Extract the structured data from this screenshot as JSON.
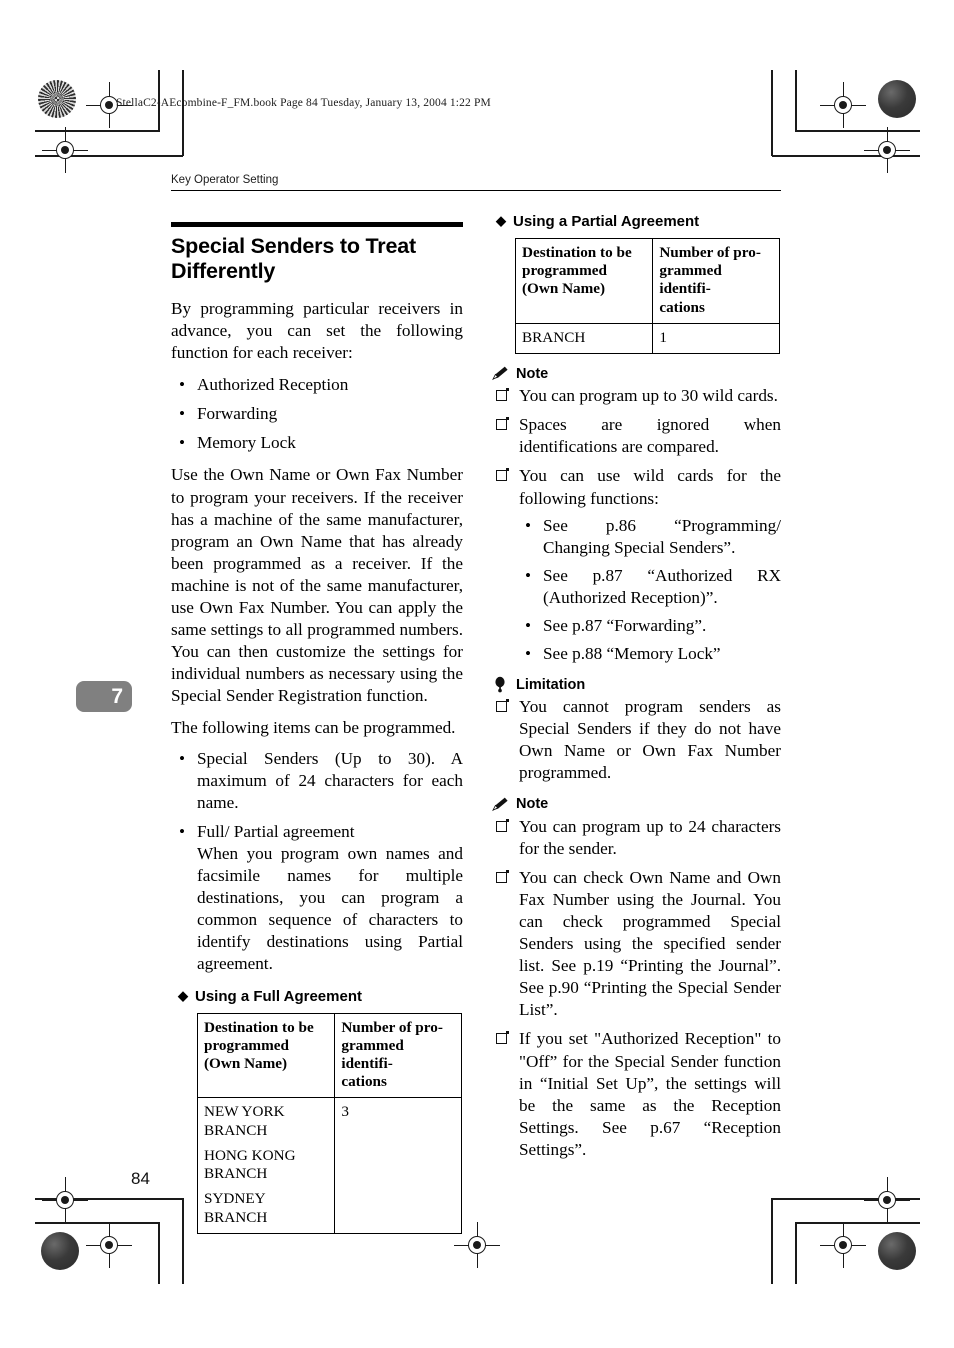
{
  "print_marks": {
    "file_header": "StellaC2-AEcombine-F_FM.book  Page 84  Tuesday, January 13, 2004  1:22 PM"
  },
  "page": {
    "running_head": "Key Operator Setting",
    "chapter_tab": "7",
    "folio": "84"
  },
  "left_column": {
    "section_title": "Special Senders to Treat Differently",
    "intro_paragraph": "By programming particular receivers in advance, you can set the following function for each receiver:",
    "feature_bullets": [
      "Authorized Reception",
      "Forwarding",
      "Memory Lock"
    ],
    "paragraph_2": "Use the Own Name or Own Fax Number to program your receivers. If the receiver has a machine of the same manufacturer, program an Own Name that has already been programmed as a receiver. If the machine is not of the same manufacturer, use Own Fax Number. You can apply the same settings to all programmed numbers. You can then customize the settings for individual numbers as necessary using the Special Sender Registration function.",
    "paragraph_3": "The following items can be programmed.",
    "program_bullets": [
      {
        "text": "Special Senders (Up to 30). A maximum of 24 characters for each name.",
        "sub": ""
      },
      {
        "text": "Full/ Partial agreement",
        "sub": "When you program own names and facsimile names for multiple destinations, you can program a common sequence of characters to identify destinations using Partial agreement."
      }
    ],
    "full_agreement": {
      "diamond": "◆",
      "heading": "Using a Full Agreement",
      "col1_header": [
        "Destination to be",
        "programmed",
        "(Own Name)"
      ],
      "col2_header": [
        "Number of pro-",
        "grammed identifi-",
        "cations"
      ],
      "rows": [
        {
          "destination": [
            "NEW YORK",
            "BRANCH",
            "HONG KONG",
            "BRANCH",
            "SYDNEY",
            "BRANCH"
          ],
          "count": "3"
        }
      ]
    }
  },
  "right_column": {
    "partial_agreement": {
      "diamond": "◆",
      "heading": "Using a Partial Agreement",
      "col1_header": [
        "Destination to be",
        "programmed",
        "(Own Name)"
      ],
      "col2_header": [
        "Number of pro-",
        "grammed identifi-",
        "cations"
      ],
      "rows": [
        {
          "destination": [
            "BRANCH"
          ],
          "count": "1"
        }
      ]
    },
    "note_1": {
      "icon": "pencil-icon",
      "label": "Note",
      "items": [
        "You can program up to 30 wild cards.",
        "Spaces are ignored when identifications are compared.",
        "You can use wild cards for the following functions:"
      ],
      "sub_items": [
        "See p.86 “Programming/ Changing Special Senders”.",
        "See p.87 “Authorized RX (Authorized Reception)”.",
        "See p.87 “Forwarding”.",
        "See p.88 “Memory Lock”"
      ]
    },
    "limitation": {
      "icon": "balloon-icon",
      "label": "Limitation",
      "items": [
        "You cannot program senders as Special Senders if they do not have Own Name or Own Fax Number programmed."
      ]
    },
    "note_2": {
      "icon": "pencil-icon",
      "label": "Note",
      "items": [
        "You can program up to 24 characters for the sender.",
        "You can check Own Name and Own Fax Number using the Journal. You can check programmed Special Senders using the specified sender list. See p.19 “Printing the Journal”. See p.90 “Printing the Special Sender List”.",
        "If you set \"Authorized Reception\" to \"Off” for the Special Sender function in “Initial Set Up”, the settings will be the same as the Reception Settings. See p.67 “Reception Settings”."
      ]
    }
  },
  "colors": {
    "chapter_tab_bg": "#808080",
    "text": "#000000",
    "rule": "#000000"
  }
}
